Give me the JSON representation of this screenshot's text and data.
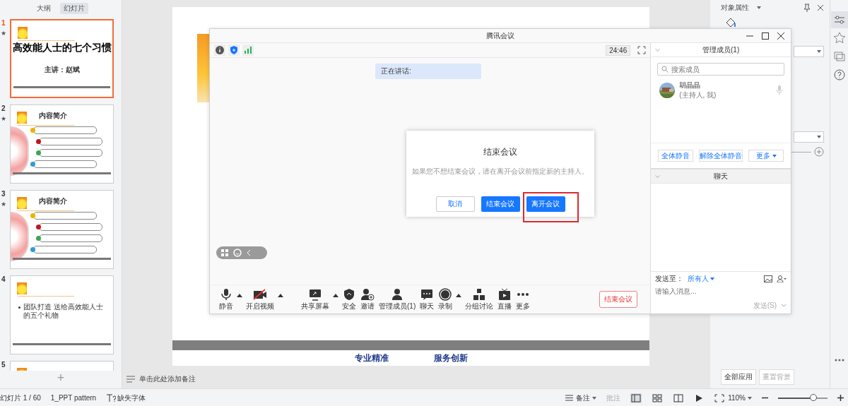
{
  "slide_panel": {
    "tabs": [
      {
        "label": "大纲",
        "selected": false
      },
      {
        "label": "幻灯片",
        "selected": true
      }
    ],
    "slides": [
      {
        "number": "1",
        "selected": true,
        "mark": "★",
        "kind": "title",
        "title": "高效能人士的七个习惯",
        "subtitle": "主讲：赵斌"
      },
      {
        "number": "2",
        "selected": false,
        "mark": "★",
        "kind": "list",
        "title": "内容简介",
        "bullets": [
          {
            "color": "#e8b400"
          },
          {
            "color": "#c0161c"
          },
          {
            "color": "#3aa655"
          },
          {
            "color": "#2f9bd6"
          }
        ]
      },
      {
        "number": "3",
        "selected": false,
        "mark": "★",
        "kind": "list",
        "title": "内容简介",
        "bullets": [
          {
            "color": "#e8b400"
          },
          {
            "color": "#c0161c"
          },
          {
            "color": "#3aa655"
          },
          {
            "color": "#2f9bd6"
          }
        ]
      },
      {
        "number": "4",
        "selected": false,
        "kind": "bullet",
        "bullet": "团队打造 送给高效能人士的五个礼物"
      },
      {
        "number": "5",
        "selected": false,
        "kind": "partial"
      }
    ],
    "add_button": "+"
  },
  "slide": {
    "footer": [
      "专业精准",
      "服务创新"
    ]
  },
  "notes": {
    "placeholder": "单击此处添加备注"
  },
  "properties": {
    "title": "对象属性",
    "buttons": [
      {
        "label": "全部应用",
        "disabled": false
      },
      {
        "label": "重置背景",
        "disabled": true
      }
    ]
  },
  "status_bar": {
    "slide_count": "幻灯片 1 / 60",
    "template": "1_PPT pattern",
    "missing_fonts": "缺失字体",
    "notes": "备注",
    "comments": "批注",
    "zoom": "110%",
    "level": 0.72
  },
  "meeting": {
    "title": "腾讯会议",
    "timer": "24:46",
    "speaking": "正在讲话:",
    "toolbar": [
      {
        "label": "静音",
        "caret": true
      },
      {
        "label": "开启视频",
        "caret": true
      },
      {
        "label": "共享屏幕",
        "caret": true
      },
      {
        "label": "安全",
        "caret": false
      },
      {
        "label": "邀请",
        "caret": false
      },
      {
        "label": "管理成员(1)",
        "caret": false
      },
      {
        "label": "聊天",
        "caret": false
      },
      {
        "label": "录制",
        "caret": true
      },
      {
        "label": "分组讨论",
        "caret": false
      },
      {
        "label": "直播",
        "caret": false
      },
      {
        "label": "更多",
        "caret": false
      }
    ],
    "end_button": "结束会议",
    "members": {
      "header": "管理成员(1)",
      "search_placeholder": "搜索成员",
      "list": [
        {
          "name": "胡晶晶",
          "role": "(主持人, 我)"
        }
      ],
      "buttons": [
        "全体静音",
        "解除全体静音",
        "更多"
      ]
    },
    "chat": {
      "header": "聊天",
      "send_to_label": "发送至：",
      "recipient": "所有人",
      "placeholder": "请输入消息...",
      "send_button": "发送(S)"
    },
    "dialog": {
      "title": "结束会议",
      "message": "如果您不想结束会议，请在离开会议前指定新的主持人。",
      "buttons": [
        {
          "label": "取消",
          "kind": "secondary",
          "highlighted": false
        },
        {
          "label": "结束会议",
          "kind": "primary",
          "highlighted": false
        },
        {
          "label": "离开会议",
          "kind": "primary",
          "highlighted": true
        }
      ]
    }
  }
}
